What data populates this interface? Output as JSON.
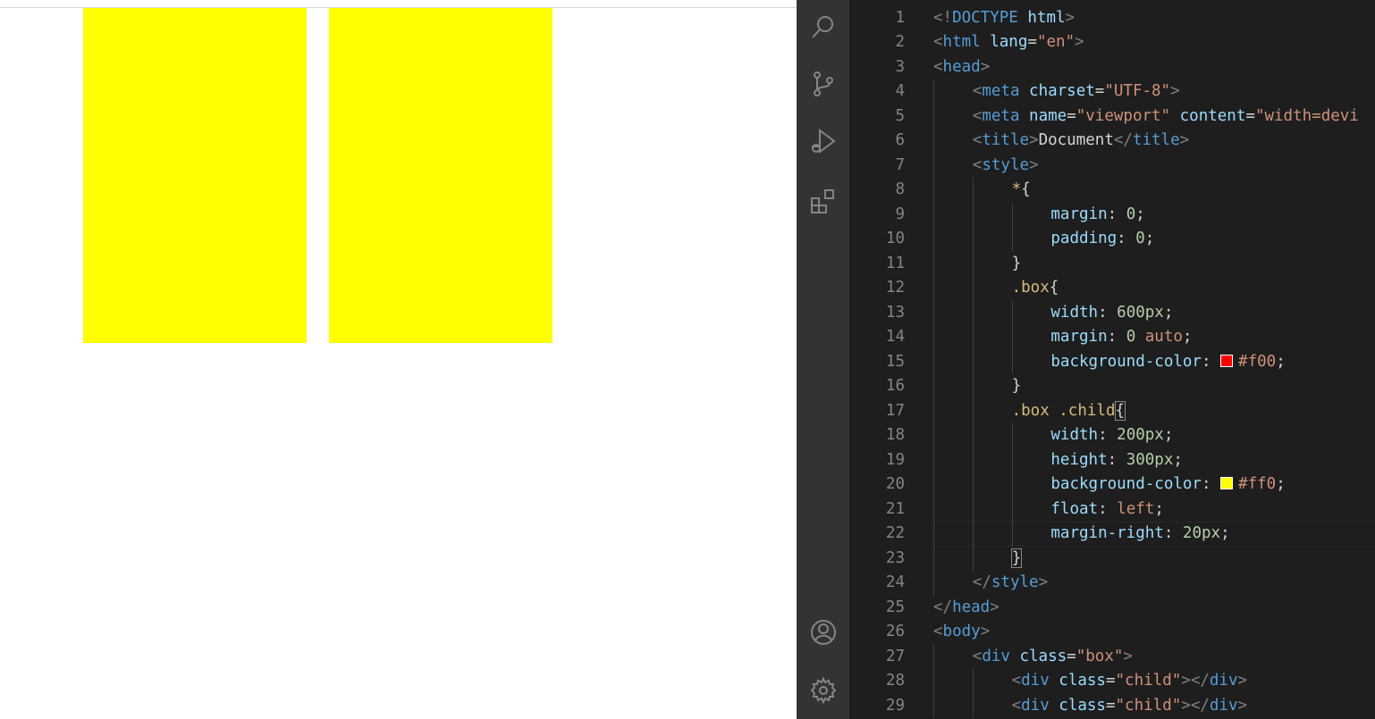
{
  "preview": {
    "child_color": "#ffff00"
  },
  "activity_bar": {
    "icons": [
      "search-icon",
      "source-control-icon",
      "run-debug-icon",
      "extensions-icon",
      "account-icon",
      "settings-gear-icon"
    ]
  },
  "editor": {
    "line_numbers": [
      "1",
      "2",
      "3",
      "4",
      "5",
      "6",
      "7",
      "8",
      "9",
      "10",
      "11",
      "12",
      "13",
      "14",
      "15",
      "16",
      "17",
      "18",
      "19",
      "20",
      "21",
      "22",
      "23",
      "24",
      "25",
      "26",
      "27",
      "28",
      "29"
    ],
    "lines": {
      "l1": {
        "a": "<!",
        "b": "DOCTYPE",
        "c": " html",
        "d": ">"
      },
      "l2": {
        "a": "<",
        "b": "html",
        "c": " lang",
        "d": "=",
        "e": "\"en\"",
        "f": ">"
      },
      "l3": {
        "a": "<",
        "b": "head",
        "c": ">"
      },
      "l4": {
        "a": "<",
        "b": "meta",
        "c": " charset",
        "d": "=",
        "e": "\"UTF-8\"",
        "f": ">"
      },
      "l5": {
        "a": "<",
        "b": "meta",
        "c": " name",
        "d": "=",
        "e": "\"viewport\"",
        "f": " content",
        "g": "=",
        "h": "\"width=devi"
      },
      "l6": {
        "a": "<",
        "b": "title",
        "c": ">",
        "d": "Document",
        "e": "</",
        "f": "title",
        "g": ">"
      },
      "l7": {
        "a": "<",
        "b": "style",
        "c": ">"
      },
      "l8": {
        "a": "*",
        "b": "{"
      },
      "l9": {
        "a": "margin",
        "b": ": ",
        "c": "0",
        "d": ";"
      },
      "l10": {
        "a": "padding",
        "b": ": ",
        "c": "0",
        "d": ";"
      },
      "l11": {
        "a": "}"
      },
      "l12": {
        "a": ".box",
        "b": "{"
      },
      "l13": {
        "a": "width",
        "b": ": ",
        "c": "600px",
        "d": ";"
      },
      "l14": {
        "a": "margin",
        "b": ": ",
        "c": "0",
        "d": " auto",
        "e": ";"
      },
      "l15": {
        "a": "background-color",
        "b": ": ",
        "c": "#f00",
        "d": ";",
        "swatch": "#ff0000"
      },
      "l16": {
        "a": "}"
      },
      "l17": {
        "a": ".box .child",
        "b": "{"
      },
      "l18": {
        "a": "width",
        "b": ": ",
        "c": "200px",
        "d": ";"
      },
      "l19": {
        "a": "height",
        "b": ": ",
        "c": "300px",
        "d": ";"
      },
      "l20": {
        "a": "background-color",
        "b": ": ",
        "c": "#ff0",
        "d": ";",
        "swatch": "#ffff00"
      },
      "l21": {
        "a": "float",
        "b": ": ",
        "c": "left",
        "d": ";"
      },
      "l22": {
        "a": "margin-right",
        "b": ": ",
        "c": "20px",
        "d": ";"
      },
      "l23": {
        "a": "}"
      },
      "l24": {
        "a": "</",
        "b": "style",
        "c": ">"
      },
      "l25": {
        "a": "</",
        "b": "head",
        "c": ">"
      },
      "l26": {
        "a": "<",
        "b": "body",
        "c": ">"
      },
      "l27": {
        "a": "<",
        "b": "div",
        "c": " class",
        "d": "=",
        "e": "\"box\"",
        "f": ">"
      },
      "l28": {
        "a": "<",
        "b": "div",
        "c": " class",
        "d": "=",
        "e": "\"child\"",
        "f": "></",
        "g": "div",
        "h": ">"
      },
      "l29": {
        "a": "<",
        "b": "div",
        "c": " class",
        "d": "=",
        "e": "\"child\"",
        "f": "></",
        "g": "div",
        "h": ">"
      }
    }
  },
  "colors": {
    "editor_bg": "#1e1e1e",
    "activity_bar_bg": "#333333",
    "tag": "#569cd6",
    "attribute": "#9cdcfe",
    "string": "#ce9178",
    "selector": "#d7ba7d",
    "number": "#b5cea8"
  }
}
